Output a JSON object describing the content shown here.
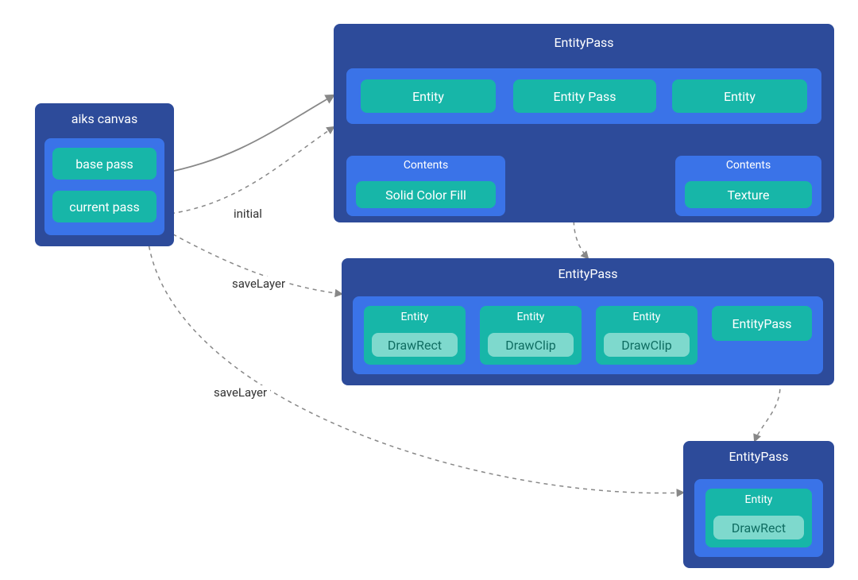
{
  "canvas": {
    "title": "aiks canvas",
    "base_pass": "base pass",
    "current_pass": "current pass"
  },
  "entity_pass_1": {
    "title": "EntityPass",
    "entity_a": "Entity",
    "entity_pass_child": "Entity Pass",
    "entity_b": "Entity",
    "contents_a_title": "Contents",
    "contents_a_fill": "Solid Color Fill",
    "contents_b_title": "Contents",
    "contents_b_fill": "Texture"
  },
  "entity_pass_2": {
    "title": "EntityPass",
    "entity_a": {
      "label": "Entity",
      "op": "DrawRect"
    },
    "entity_b": {
      "label": "Entity",
      "op": "DrawClip"
    },
    "entity_c": {
      "label": "Entity",
      "op": "DrawClip"
    },
    "entity_pass_child": "EntityPass"
  },
  "entity_pass_3": {
    "title": "EntityPass",
    "entity": {
      "label": "Entity",
      "op": "DrawRect"
    }
  },
  "edges": {
    "initial": "initial",
    "save_layer_1": "saveLayer",
    "save_layer_2": "saveLayer"
  }
}
